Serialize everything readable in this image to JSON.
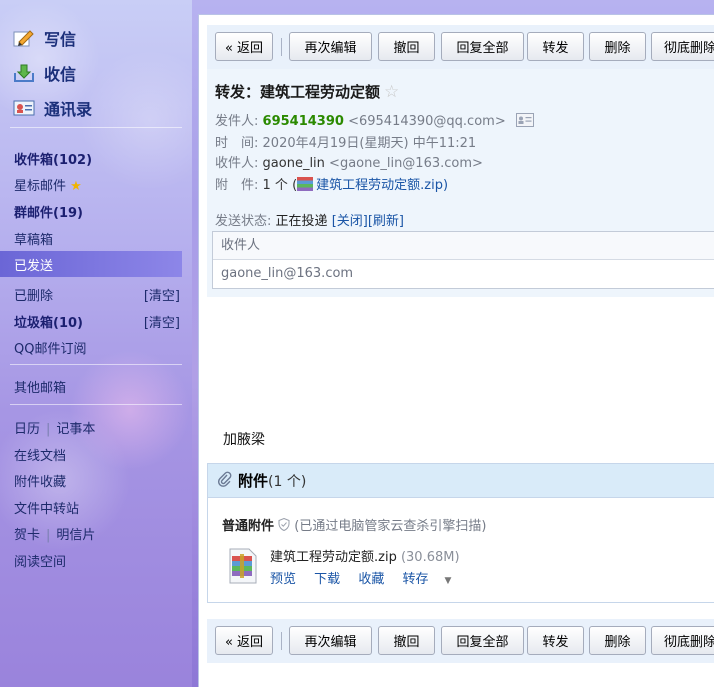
{
  "sidebar": {
    "write": "写信",
    "receive": "收信",
    "contacts": "通讯录",
    "folders": {
      "inbox": "收件箱(102)",
      "starred": "星标邮件",
      "group": "群邮件(19)",
      "drafts": "草稿箱",
      "sent": "已发送",
      "deleted": "已删除",
      "deleted_action": "[清空]",
      "spam": "垃圾箱(10)",
      "spam_action": "[清空]",
      "subscriptions": "QQ邮件订阅",
      "other": "其他邮箱"
    },
    "tools": {
      "calendar": "日历",
      "notes": "记事本",
      "docs": "在线文档",
      "att_favorites": "附件收藏",
      "transfer": "文件中转站",
      "cards": "贺卡",
      "postcards": "明信片",
      "reading": "阅读空间"
    },
    "pipe": "|"
  },
  "toolbar": {
    "back": "« 返回",
    "reedit": "再次编辑",
    "recall": "撤回",
    "reply_all": "回复全部",
    "forward": "转发",
    "delete": "删除",
    "delete_forever": "彻底删除"
  },
  "email": {
    "subject": "转发：建筑工程劳动定额",
    "star": "☆",
    "from_label": "发件人:",
    "from_name": "695414390",
    "from_addr": "<695414390@qq.com>",
    "time_label": "时　间:",
    "time_value": "2020年4月19日(星期天) 中午11:21",
    "to_label": "收件人:",
    "to_name": "gaone_lin",
    "to_addr": "<gaone_lin@163.com>",
    "att_label": "附　件:",
    "att_value_prefix": "1 个 (",
    "att_value_file": "建筑工程劳动定额.zip",
    "att_value_suffix": ")",
    "status_label": "发送状态:",
    "status_value": "正在投递",
    "status_close": "[关闭]",
    "status_refresh": "[刷新]",
    "recipient_header": "收件人",
    "recipient_value": "gaone_lin@163.com",
    "body": "加腋梁"
  },
  "attachments": {
    "title": "附件",
    "count": "(1 个)",
    "type_label": "普通附件",
    "scan_note": "(已通过电脑管家云查杀引擎扫描)",
    "file_name": "建筑工程劳动定额.zip",
    "file_size": "(30.68M)",
    "preview": "预览",
    "download": "下载",
    "favorite": "收藏",
    "save_to": "转存"
  },
  "colors": {
    "accent": "#1a55a6",
    "sender": "#2b8a00",
    "sidebar_active": "#6b66d6"
  }
}
